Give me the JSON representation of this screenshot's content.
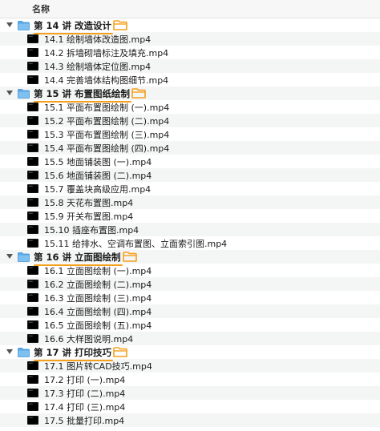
{
  "header": {
    "name_label": "名称"
  },
  "groups": [
    {
      "title": "第 14 讲 改造设计",
      "files": [
        "14.1 绘制墙体改造图.mp4",
        "14.2 拆墙砌墙标注及填充.mp4",
        "14.3 绘制墙体定位图.mp4",
        "14.4 完善墙体结构图细节.mp4"
      ]
    },
    {
      "title": "第 15 讲 布置图纸绘制",
      "files": [
        "15.1 平面布置图绘制 (一).mp4",
        "15.2 平面布置图绘制 (二).mp4",
        "15.3 平面布置图绘制 (三).mp4",
        "15.4 平面布置图绘制 (四).mp4",
        "15.5 地面铺装图 (一).mp4",
        "15.6 地面铺装图 (二).mp4",
        "15.7 覆盖块高级应用.mp4",
        "15.8 天花布置图.mp4",
        "15.9 开关布置图.mp4",
        "15.10 插座布置图.mp4",
        "15.11 给排水、空调布置图、立面索引图.mp4"
      ]
    },
    {
      "title": "第 16 讲 立面图绘制",
      "files": [
        "16.1 立面图绘制 (一).mp4",
        "16.2 立面图绘制 (二).mp4",
        "16.3 立面图绘制 (三).mp4",
        "16.4 立面图绘制 (四).mp4",
        "16.5 立面图绘制 (五).mp4",
        "16.6 大样图说明.mp4"
      ]
    },
    {
      "title": "第 17 讲 打印技巧",
      "files": [
        "17.1 图片转CAD技巧.mp4",
        "17.2 打印 (一).mp4",
        "17.3 打印 (二).mp4",
        "17.4 打印 (三).mp4",
        "17.5 批量打印.mp4"
      ]
    }
  ],
  "colors": {
    "folder_blue": "#5aa9e6",
    "highlight_orange": "#f4a01c",
    "row_alt": "#f4f5f5"
  },
  "icons": {
    "disclosure": "chevron-down-icon",
    "folder": "folder-icon",
    "highlight": "orange-folder-icon",
    "file": "video-file-icon"
  }
}
